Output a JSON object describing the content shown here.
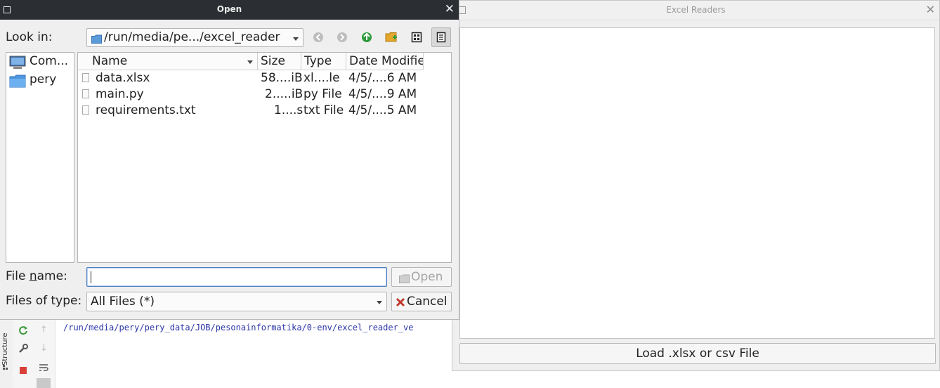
{
  "ide": {
    "path_text": "/run/media/pery/pery_data/JOB/pesonainformatika/0-env/excel_reader_ve",
    "structure_label": "Structure"
  },
  "excel_window": {
    "title": "Excel Readers",
    "load_button": "Load .xlsx or csv File"
  },
  "dialog": {
    "title": "Open",
    "look_in_label": "Look in:",
    "look_in_value": "/run/media/pe.../excel_reader",
    "sidebar": [
      {
        "label": "Com...",
        "icon": "computer-icon"
      },
      {
        "label": "pery",
        "icon": "folder-icon"
      }
    ],
    "columns": [
      "Name",
      "Size",
      "Type",
      "Date Modifie"
    ],
    "files": [
      {
        "name": "data.xlsx",
        "size": "58....iB",
        "type": "xl....le",
        "date": "4/5/....6 AM"
      },
      {
        "name": "main.py",
        "size": "2.....iB",
        "type": "py File",
        "date": "4/5/....9 AM"
      },
      {
        "name": "requirements.txt",
        "size": "1....s",
        "type": "txt File",
        "date": "4/5/....5 AM"
      }
    ],
    "file_name_label_pre": "File ",
    "file_name_label_u": "n",
    "file_name_label_post": "ame:",
    "file_name_value": "",
    "open_button": "Open",
    "files_of_type_label": "Files of type:",
    "files_of_type_value": "All Files (*)",
    "cancel_button": "Cancel"
  }
}
